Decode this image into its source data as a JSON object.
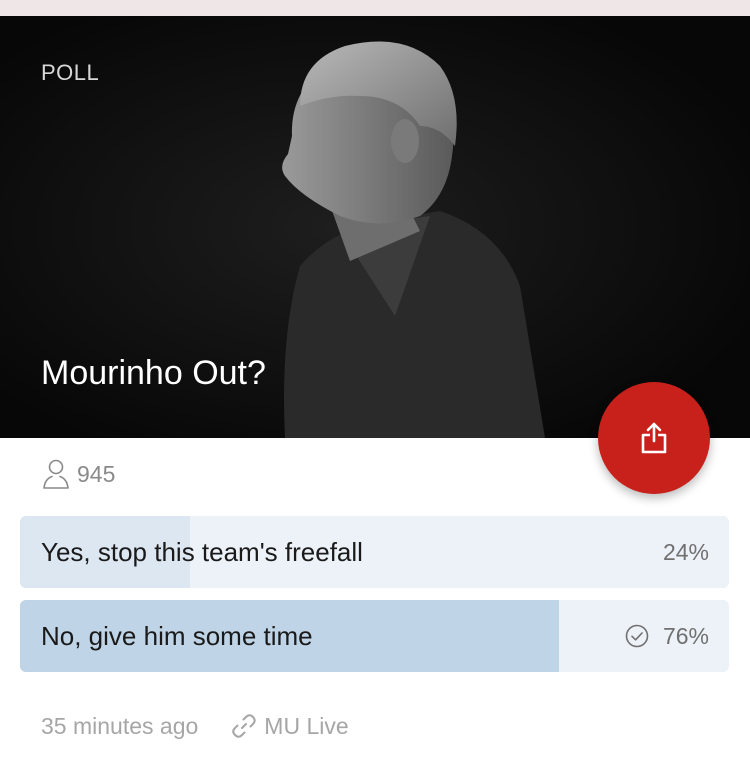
{
  "poll": {
    "tag": "POLL",
    "title": "Mourinho Out?",
    "voters": "945",
    "options": [
      {
        "label": "Yes, stop this team's freefall",
        "percent": "24%",
        "share": 0.24,
        "selected": false
      },
      {
        "label": "No, give him some time",
        "percent": "76%",
        "share": 0.76,
        "selected": true
      }
    ]
  },
  "footer": {
    "time": "35 minutes ago",
    "source": "MU Live"
  },
  "icons": {
    "share": "share-icon",
    "voters": "user-icon",
    "selected": "check-circle-icon",
    "source": "link-icon"
  },
  "colors": {
    "share_button": "#c8201a",
    "option_track": "#edf2f8",
    "option_fill": "#dde7f2",
    "option_fill_selected": "#bfd4e6"
  }
}
